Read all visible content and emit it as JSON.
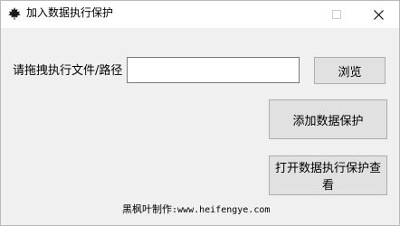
{
  "window": {
    "title": "加入数据执行保护",
    "icon": "maple-leaf-icon",
    "controls": {
      "minimize": "minimize-icon",
      "maximize": "maximize-icon",
      "close": "close-icon"
    }
  },
  "form": {
    "path_label": "请拖拽执行文件/路径",
    "path_value": "",
    "browse_label": "浏览",
    "add_label": "添加数据保护",
    "view_label": "打开数据执行保护查看"
  },
  "footer": {
    "credit_label": "黑枫叶制作",
    "separator": ":",
    "url": "www.heifengye.com"
  },
  "colors": {
    "title_bar": "#ffffff",
    "client_bg": "#f0f0f0",
    "button_bg": "#e1e1e1",
    "button_border": "#adadad"
  }
}
